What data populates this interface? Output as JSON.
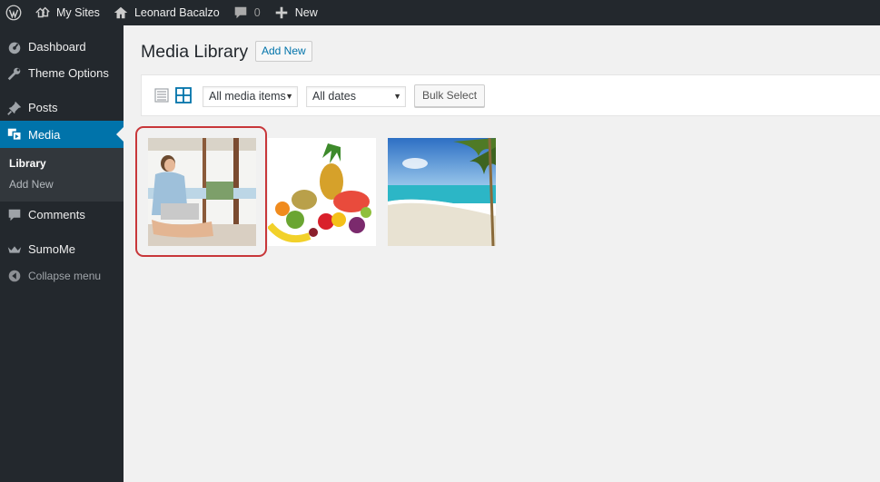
{
  "admin_bar": {
    "wp_logo_icon": "wordpress-logo-icon",
    "my_sites": "My Sites",
    "site_name": "Leonard Bacalzo",
    "comments_count": "0",
    "new_label": "New"
  },
  "sidebar": {
    "items": [
      {
        "label": "Dashboard",
        "icon": "dashboard-icon"
      },
      {
        "label": "Theme Options",
        "icon": "wrench-icon"
      },
      {
        "label": "Posts",
        "icon": "pin-icon"
      },
      {
        "label": "Media",
        "icon": "media-icon"
      },
      {
        "label": "Comments",
        "icon": "comment-icon"
      },
      {
        "label": "SumoMe",
        "icon": "crown-icon"
      }
    ],
    "media_submenu": [
      "Library",
      "Add New"
    ],
    "collapse_label": "Collapse menu"
  },
  "main": {
    "title": "Media Library",
    "add_new": "Add New",
    "filters": {
      "type_selected": "All media items",
      "date_selected": "All dates"
    },
    "bulk_select": "Bulk Select",
    "view_modes": [
      "list-view-icon",
      "grid-view-icon"
    ],
    "active_view": "grid"
  },
  "colors": {
    "admin_dark": "#23282d",
    "accent_blue": "#0073aa",
    "highlight_red": "#c8373a"
  }
}
